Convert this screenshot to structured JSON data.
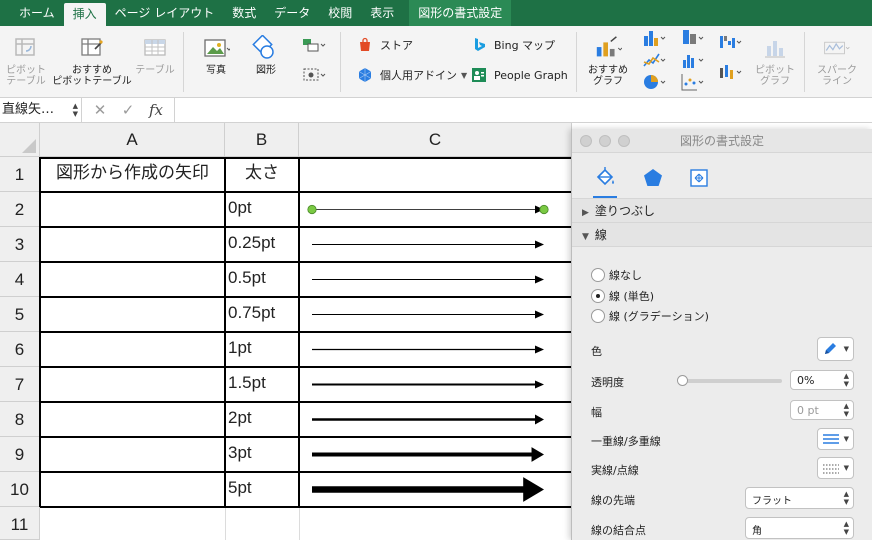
{
  "ribbon_tabs": [
    {
      "label": "ホーム"
    },
    {
      "label": "挿入"
    },
    {
      "label": "ページ レイアウト"
    },
    {
      "label": "数式"
    },
    {
      "label": "データ"
    },
    {
      "label": "校閲"
    },
    {
      "label": "表示"
    },
    {
      "label": "図形の書式設定"
    }
  ],
  "ribbon": {
    "pivot_table": "ピボット\nテーブル",
    "recommended_pivot": "おすすめ\nピボットテーブル",
    "table": "テーブル",
    "photo": "写真",
    "shapes": "図形",
    "store": "ストア",
    "personal_addins": "個人用アドイン",
    "bing_maps": "Bing マップ",
    "people_graph": "People Graph",
    "recommended_charts": "おすすめ\nグラフ",
    "pivot_chart": "ピボット\nグラフ",
    "sparkline": "スパーク\nライン"
  },
  "formula_bar": {
    "name_box": "直線矢…",
    "cancel": "✕",
    "enter": "✓",
    "fx": "fx",
    "value": ""
  },
  "columns": [
    "A",
    "B",
    "C"
  ],
  "rows": [
    {
      "num": "1",
      "a": "図形から作成の矢印",
      "b": "太さ",
      "weight": null
    },
    {
      "num": "2",
      "a": "",
      "b": "0pt",
      "weight": 0
    },
    {
      "num": "3",
      "a": "",
      "b": "0.25pt",
      "weight": 0.25
    },
    {
      "num": "4",
      "a": "",
      "b": "0.5pt",
      "weight": 0.5
    },
    {
      "num": "5",
      "a": "",
      "b": "0.75pt",
      "weight": 0.75
    },
    {
      "num": "6",
      "a": "",
      "b": "1pt",
      "weight": 1
    },
    {
      "num": "7",
      "a": "",
      "b": "1.5pt",
      "weight": 1.5
    },
    {
      "num": "8",
      "a": "",
      "b": "2pt",
      "weight": 2
    },
    {
      "num": "9",
      "a": "",
      "b": "3pt",
      "weight": 3
    },
    {
      "num": "10",
      "a": "",
      "b": "5pt",
      "weight": 5
    },
    {
      "num": "11",
      "a": "",
      "b": "",
      "weight": null
    }
  ],
  "format_pane": {
    "title": "図形の書式設定",
    "section_fill": "塗りつぶし",
    "section_line": "線",
    "radio_none": "線なし",
    "radio_solid": "線 (単色)",
    "radio_gradient": "線 (グラデーション)",
    "color_label": "色",
    "transparency_label": "透明度",
    "transparency_value": "0%",
    "transparency_level": 0,
    "width_label": "幅",
    "width_placeholder": "0 pt",
    "compound_label": "一重線/多重線",
    "dash_label": "実線/点線",
    "cap_label": "線の先端",
    "cap_value": "フラット",
    "join_label": "線の結合点",
    "join_value": "角"
  },
  "colors": {
    "ribbon_green": "#1e7145",
    "handle_green": "#7ac943",
    "accent_blue": "#2a7de1"
  }
}
